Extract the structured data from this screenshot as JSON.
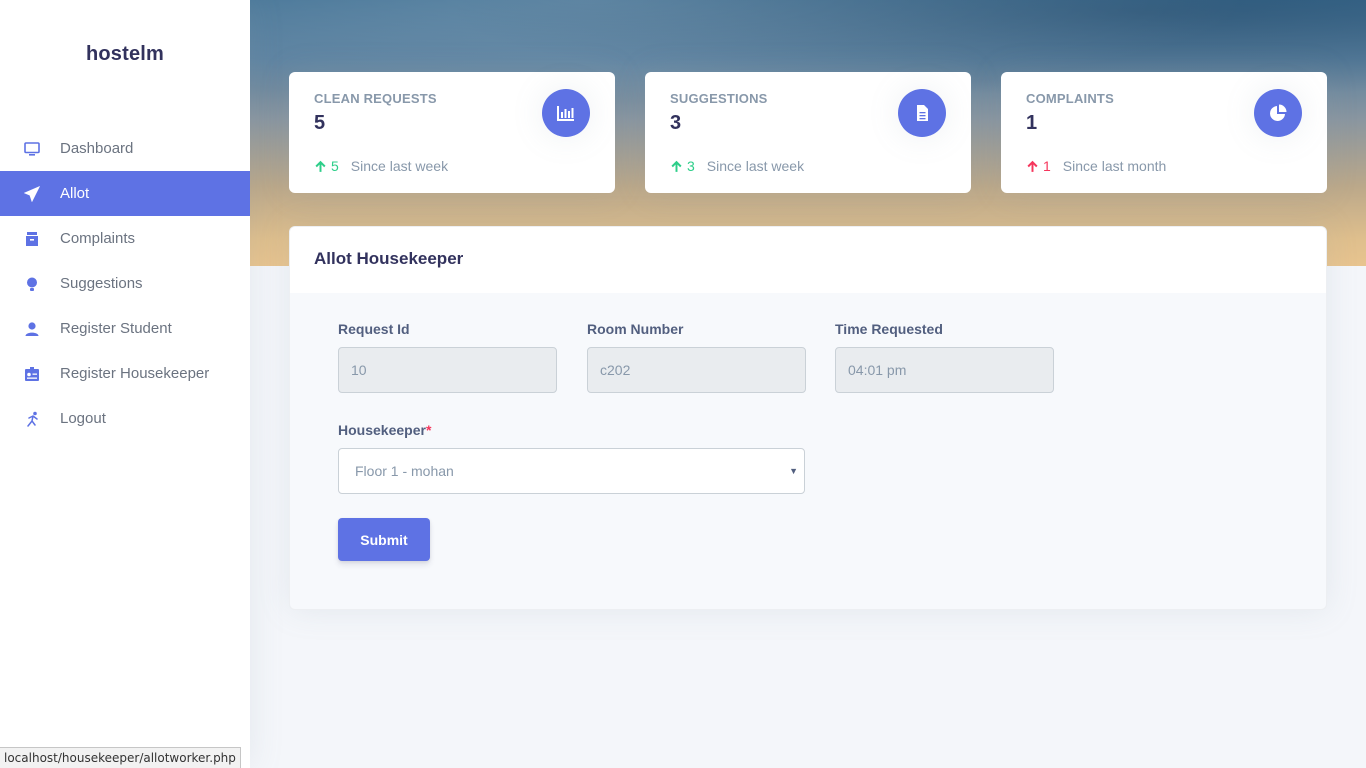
{
  "brand": "hostelm",
  "sidebar": {
    "items": [
      {
        "label": "Dashboard",
        "icon": "monitor-icon"
      },
      {
        "label": "Allot",
        "icon": "send-icon",
        "active": true
      },
      {
        "label": "Complaints",
        "icon": "archive-icon"
      },
      {
        "label": "Suggestions",
        "icon": "bulb-icon"
      },
      {
        "label": "Register Student",
        "icon": "user-icon"
      },
      {
        "label": "Register Housekeeper",
        "icon": "badge-icon"
      },
      {
        "label": "Logout",
        "icon": "running-icon"
      }
    ]
  },
  "stats": [
    {
      "title": "CLEAN REQUESTS",
      "value": "5",
      "delta": "5",
      "since": "Since last week",
      "trend_color": "#2dce89",
      "icon": "chart-bar-icon"
    },
    {
      "title": "SUGGESTIONS",
      "value": "3",
      "delta": "3",
      "since": "Since last week",
      "trend_color": "#2dce89",
      "icon": "document-icon"
    },
    {
      "title": "COMPLAINTS",
      "value": "1",
      "delta": "1",
      "since": "Since last month",
      "trend_color": "#f5365c",
      "icon": "pie-chart-icon"
    }
  ],
  "form": {
    "title": "Allot Housekeeper",
    "request_id_label": "Request Id",
    "request_id_value": "10",
    "room_number_label": "Room Number",
    "room_number_value": "c202",
    "time_requested_label": "Time Requested",
    "time_requested_value": "04:01 pm",
    "housekeeper_label": "Housekeeper",
    "required_mark": "*",
    "housekeeper_selected": "Floor 1 - mohan",
    "submit_label": "Submit"
  },
  "statusbar": "localhost/housekeeper/allotworker.php",
  "colors": {
    "accent": "#5e72e4",
    "success": "#2dce89",
    "danger": "#f5365c"
  }
}
